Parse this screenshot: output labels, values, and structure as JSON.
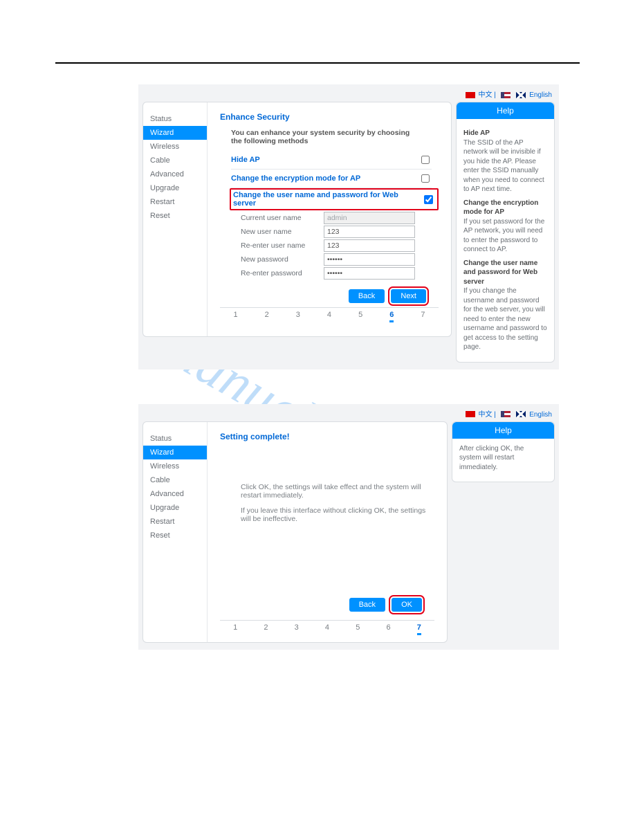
{
  "watermark": "manualshive.co",
  "lang": {
    "cn": "中文",
    "en": "English",
    "sep": " | "
  },
  "sidebar": {
    "items": [
      "Status",
      "Wizard",
      "Wireless",
      "Cable",
      "Advanced",
      "Upgrade",
      "Restart",
      "Reset"
    ],
    "active": "Wizard"
  },
  "screenshot1": {
    "title": "Enhance Security",
    "intro": "You can enhance your system security by choosing the following methods",
    "sect_hide": "Hide AP",
    "sect_enc": "Change the encryption mode for AP",
    "sect_user": "Change the user name and password for Web server",
    "sect_user_checked": true,
    "fields": {
      "cur_user_label": "Current user name",
      "cur_user_value": "admin",
      "new_user_label": "New user name",
      "new_user_value": "123",
      "re_user_label": "Re-enter user name",
      "re_user_value": "123",
      "new_pw_label": "New password",
      "new_pw_value": "••••••",
      "re_pw_label": "Re-enter password",
      "re_pw_value": "••••••"
    },
    "btn_back": "Back",
    "btn_next": "Next",
    "steps": [
      "1",
      "2",
      "3",
      "4",
      "5",
      "6",
      "7"
    ],
    "step_active": "6",
    "help": {
      "title": "Help",
      "h1": "Hide AP",
      "p1": "The SSID of the AP network will be invisible if you hide the AP. Please enter the SSID manually when you need to connect to AP next time.",
      "h2": "Change the encryption mode for AP",
      "p2": "If you set password for the AP network, you will need to enter the password to connect to AP.",
      "h3": "Change the user name and password for Web server",
      "p3": "If you change the username and password for the web server, you will need to enter the new username and password to get access to the setting page."
    }
  },
  "screenshot2": {
    "title": "Setting complete!",
    "msg1": "Click OK, the settings will take effect and the system will restart immediately.",
    "msg2": "If you leave this interface without clicking OK, the settings will be ineffective.",
    "btn_back": "Back",
    "btn_ok": "OK",
    "steps": [
      "1",
      "2",
      "3",
      "4",
      "5",
      "6",
      "7"
    ],
    "step_active": "7",
    "help": {
      "title": "Help",
      "p1": "After clicking OK, the system will restart immediately."
    }
  }
}
